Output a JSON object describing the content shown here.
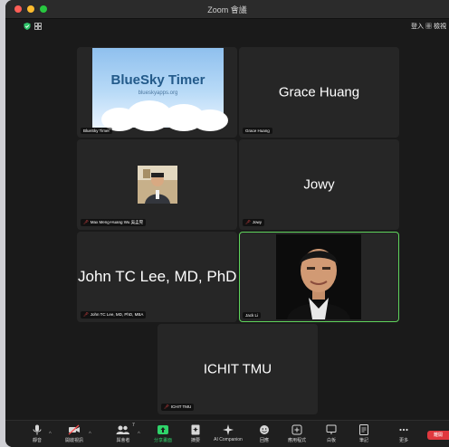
{
  "window": {
    "title": "Zoom 會議"
  },
  "topbar": {
    "login": "登入",
    "view": "檢視",
    "view_icon": "grid-view-icon"
  },
  "tiles": [
    {
      "name": "BlueSky Timer",
      "label": "BlueSky Timer",
      "content_title": "BlueSky Timer",
      "content_sub": "blueskyapps.org",
      "muted": false
    },
    {
      "name": "Grace Huang",
      "label": "Grace Huang",
      "display": "Grace Huang",
      "muted": false
    },
    {
      "name": "Max Meng-Huang Wu 吳孟晃",
      "label": "Max Meng-Huang Wu 吳孟晃",
      "muted": true
    },
    {
      "name": "Jowy",
      "label": "Jowy",
      "display": "Jowy",
      "muted": true
    },
    {
      "name": "John TC Lee, MD, PhD, MBA",
      "label": "John TC Lee, MD, PhD, MBA",
      "display": "John TC Lee, MD, PhD,...",
      "muted": true
    },
    {
      "name": "Jack Li",
      "label": "Jack Li",
      "muted": false,
      "active": true
    },
    {
      "name": "ICHIT TMU",
      "label": "ICHIT TMU",
      "display": "ICHIT TMU",
      "muted": true
    }
  ],
  "toolbar": {
    "mute": "靜音",
    "video": "開啟視訊",
    "participants": "與會者",
    "participants_count": "7",
    "share": "分享畫面",
    "summary": "摘要",
    "ai": "AI Companion",
    "react": "回應",
    "apps": "應用程式",
    "whiteboard": "白板",
    "notes": "筆記",
    "more": "更多",
    "end": "離開"
  },
  "colors": {
    "active_border": "#5fd35b",
    "share_green": "#2fd36a",
    "end_red": "#e0383e",
    "muted_red": "#ff4d4d"
  }
}
